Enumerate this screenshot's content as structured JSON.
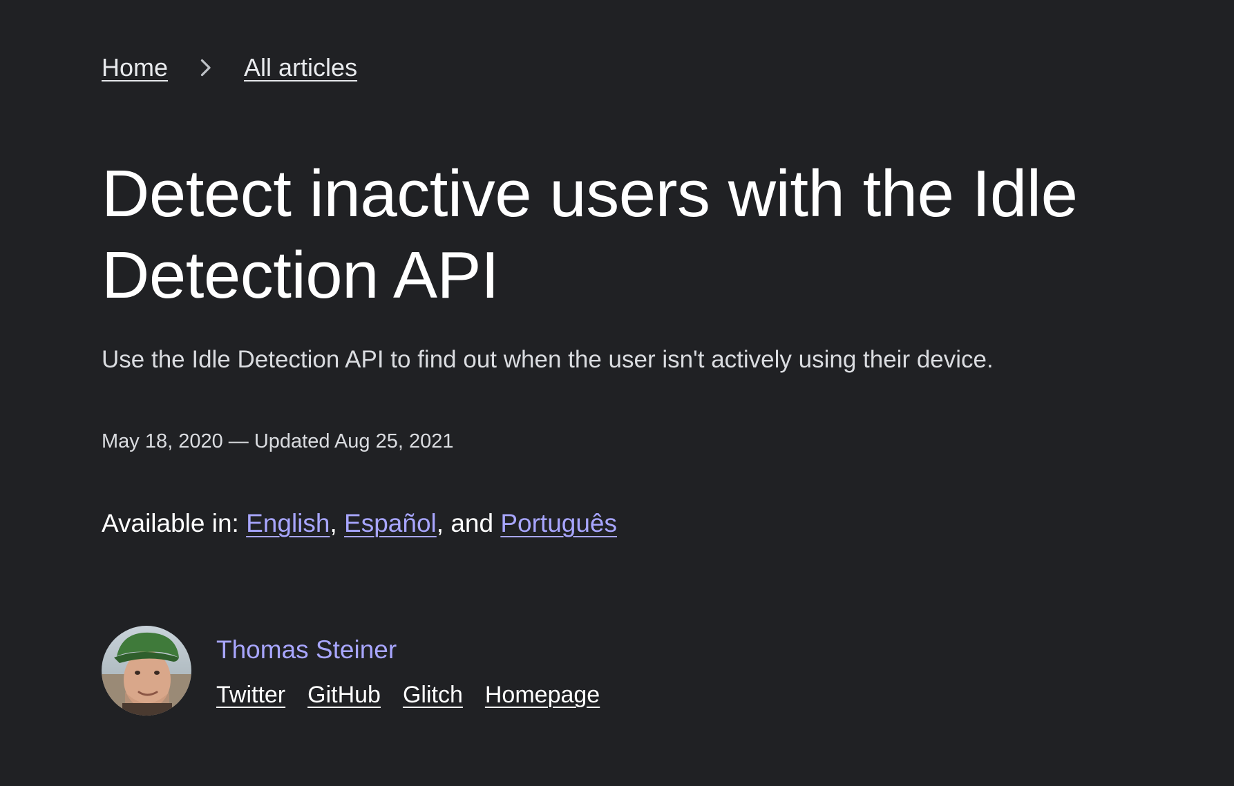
{
  "breadcrumb": {
    "home": "Home",
    "articles": "All articles",
    "separator_icon": "chevron-right-icon"
  },
  "article": {
    "title": "Detect inactive users with the Idle Detection API",
    "subtitle": "Use the Idle Detection API to find out when the user isn't actively using their device.",
    "dates": "May 18, 2020 — Updated Aug 25, 2021"
  },
  "languages": {
    "prefix": "Available in: ",
    "items": [
      "English",
      "Español",
      "Português"
    ],
    "separator": ", ",
    "conjunction": ", and "
  },
  "author": {
    "name": "Thomas Steiner",
    "links": [
      "Twitter",
      "GitHub",
      "Glitch",
      "Homepage"
    ]
  },
  "colors": {
    "background": "#202124",
    "text": "#e8eaed",
    "link_accent": "#a8a6ff"
  }
}
